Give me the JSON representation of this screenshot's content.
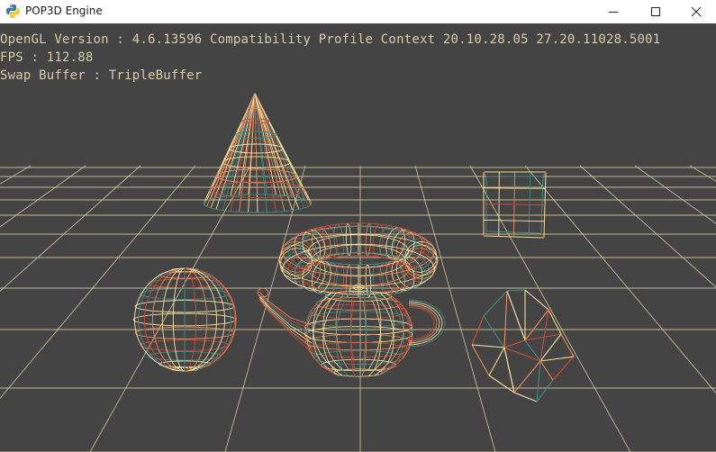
{
  "window": {
    "title": "POP3D Engine",
    "icon": "python-logo-icon",
    "controls": [
      "minimize-icon",
      "maximize-icon",
      "close-icon"
    ]
  },
  "hud": {
    "opengl": "OpenGL Version : 4.6.13596 Compatibility Profile Context 20.10.28.05 27.20.11028.5001",
    "fps": "FPS : 112.88",
    "swap": "Swap Buffer : TripleBuffer"
  },
  "scene": {
    "background": "#444444",
    "grid_color": "#d8cfa0",
    "palette": [
      "#f6dc8a",
      "#ee8a5a",
      "#cf4a36",
      "#3d8f83",
      "#f7e7b4"
    ],
    "objects": [
      "cone",
      "cube",
      "torus",
      "sphere",
      "teapot",
      "icosahedron"
    ]
  }
}
